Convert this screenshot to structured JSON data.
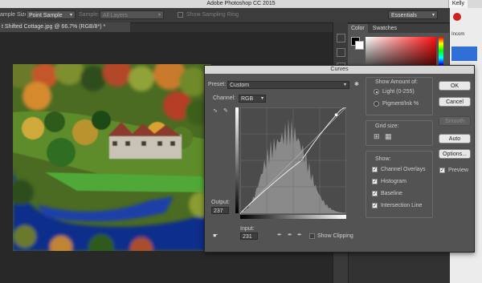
{
  "app": {
    "title": "Adobe Photoshop CC 2015",
    "user": "Kelly"
  },
  "options_bar": {
    "sample_size_label": "ample Size:",
    "sample_size_value": "Point Sample",
    "sample_label": "Sample:",
    "sample_value": "All Layers",
    "show_ring_label": "Show Sampling Ring",
    "workspace_value": "Essentials"
  },
  "document": {
    "tab_title": "t Shifted Cottage.jpg @ 66.7% (RGB/8*) *"
  },
  "panels": {
    "tabs": [
      "Color",
      "Swatches"
    ],
    "browser_label": "Incom"
  },
  "curves": {
    "title": "Curves",
    "preset_label": "Preset:",
    "preset_value": "Custom",
    "channel_label": "Channel:",
    "channel_value": "RGB",
    "output_label": "Output:",
    "output_value": "237",
    "input_label": "Input:",
    "input_value": "231",
    "show_clipping": "Show Clipping",
    "show_amount_title": "Show Amount of:",
    "light_option": "Light (0-255)",
    "pigment_option": "Pigment/Ink %",
    "grid_size_title": "Grid size:",
    "show_title": "Show:",
    "show_options": [
      "Channel Overlays",
      "Histogram",
      "Baseline",
      "Intersection Line"
    ],
    "buttons": {
      "ok": "OK",
      "cancel": "Cancel",
      "smooth": "Smooth",
      "auto": "Auto",
      "options": "Options..."
    },
    "preview_label": "Preview",
    "curve_points": [
      [
        0,
        0
      ],
      [
        148,
        128
      ],
      [
        231,
        237
      ],
      [
        255,
        255
      ]
    ]
  },
  "colors": {
    "accent": "#2f6fd6",
    "dialog_bg": "#535353"
  }
}
